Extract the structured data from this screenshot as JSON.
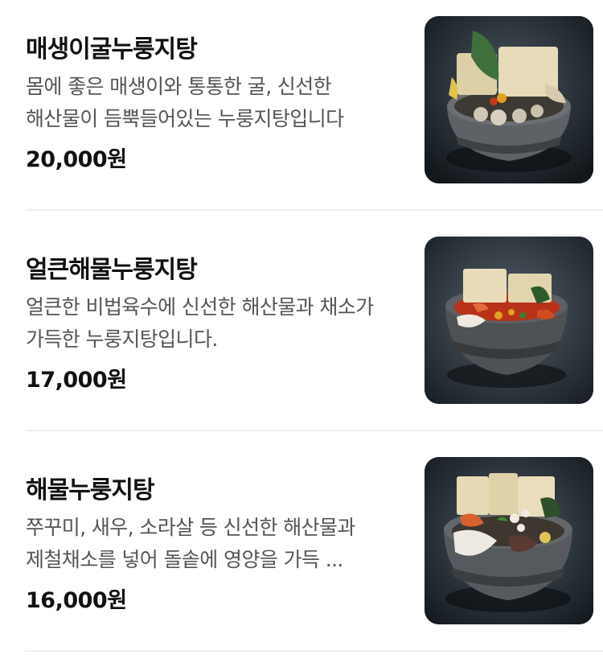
{
  "menu": {
    "items": [
      {
        "name": "매생이굴누룽지탕",
        "description": "몸에 좋은 매생이와 통통한 굴, 신선한 해산물이 듬뿍들어있는 누룽지탕입니다",
        "price": "20,000원",
        "image_icon": "stone-pot-dish-icon"
      },
      {
        "name": "얼큰해물누룽지탕",
        "description": "얼큰한 비법육수에 신선한 해산물과 채소가 가득한 누룽지탕입니다.",
        "price": "17,000원",
        "image_icon": "stone-pot-dish-icon"
      },
      {
        "name": "해물누룽지탕",
        "description": "쭈꾸미, 새우, 소라살 등 신선한 해산물과 제철채소를 넣어 돌솥에 영양을 가득 ...",
        "price": "16,000원",
        "image_icon": "stone-pot-dish-icon"
      }
    ]
  },
  "colors": {
    "text_primary": "#111111",
    "text_secondary": "#555555",
    "divider": "#efefef",
    "photo_background": "#20272c"
  }
}
